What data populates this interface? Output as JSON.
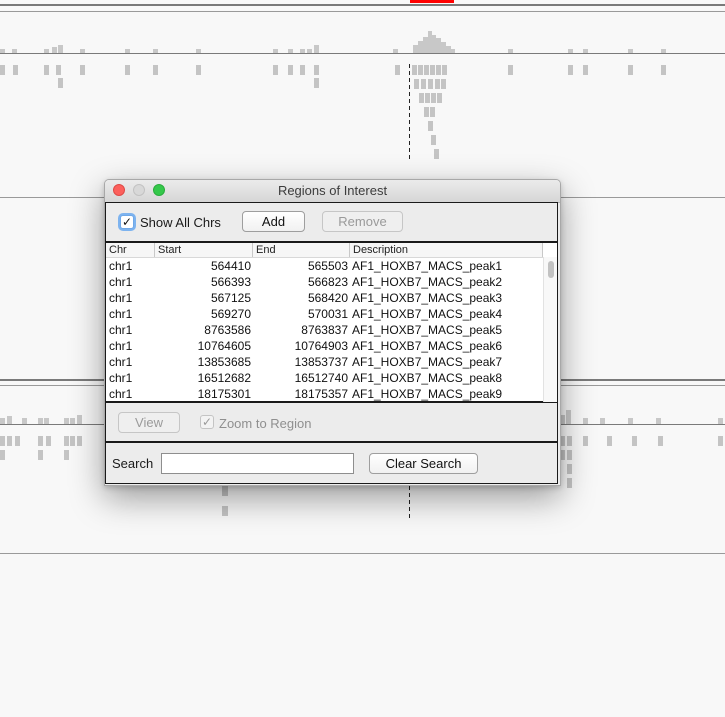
{
  "dialog": {
    "title": "Regions of Interest",
    "show_all_chrs_label": "Show All Chrs",
    "show_all_chrs_checked": true,
    "add_label": "Add",
    "remove_label": "Remove",
    "view_label": "View",
    "zoom_label": "Zoom to Region",
    "zoom_checked": true,
    "search_label": "Search",
    "search_value": "",
    "clear_label": "Clear Search",
    "check_glyph": "✓"
  },
  "table": {
    "columns": [
      "Chr",
      "Start",
      "End",
      "Description"
    ],
    "rows": [
      {
        "chr": "chr1",
        "start": "564410",
        "end": "565503",
        "desc": "AF1_HOXB7_MACS_peak1"
      },
      {
        "chr": "chr1",
        "start": "566393",
        "end": "566823",
        "desc": "AF1_HOXB7_MACS_peak2"
      },
      {
        "chr": "chr1",
        "start": "567125",
        "end": "568420",
        "desc": "AF1_HOXB7_MACS_peak3"
      },
      {
        "chr": "chr1",
        "start": "569270",
        "end": "570031",
        "desc": "AF1_HOXB7_MACS_peak4"
      },
      {
        "chr": "chr1",
        "start": "8763586",
        "end": "8763837",
        "desc": "AF1_HOXB7_MACS_peak5"
      },
      {
        "chr": "chr1",
        "start": "10764605",
        "end": "10764903",
        "desc": "AF1_HOXB7_MACS_peak6"
      },
      {
        "chr": "chr1",
        "start": "13853685",
        "end": "13853737",
        "desc": "AF1_HOXB7_MACS_peak7"
      },
      {
        "chr": "chr1",
        "start": "16512682",
        "end": "16512740",
        "desc": "AF1_HOXB7_MACS_peak8"
      },
      {
        "chr": "chr1",
        "start": "18175301",
        "end": "18175357",
        "desc": "AF1_HOXB7_MACS_peak9"
      }
    ]
  },
  "colors": {
    "background": "#f8f8f8",
    "track_lines": "#6e6e6e",
    "features": "#c4c4c4",
    "roi_marker": "#ff0000"
  }
}
